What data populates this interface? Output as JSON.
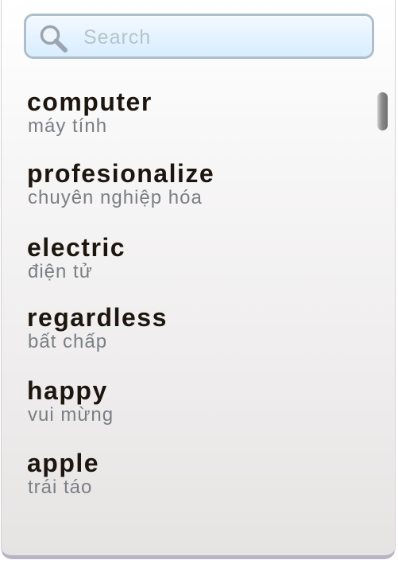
{
  "search": {
    "placeholder": "Search",
    "icon": "search-icon"
  },
  "words": [
    {
      "term": "computer",
      "meaning": "máy tính"
    },
    {
      "term": "profesionalize",
      "meaning": "chuyên nghiệp hóa"
    },
    {
      "term": "electric",
      "meaning": "điện tử"
    },
    {
      "term": "regardless",
      "meaning": "bất chấp"
    },
    {
      "term": "happy",
      "meaning": "vui mừng"
    },
    {
      "term": "apple",
      "meaning": "trái táo"
    }
  ],
  "colors": {
    "term": "#1d160f",
    "meaning": "#7a7f83",
    "search_border": "#aebfc9",
    "search_bg": "#d8edff"
  }
}
